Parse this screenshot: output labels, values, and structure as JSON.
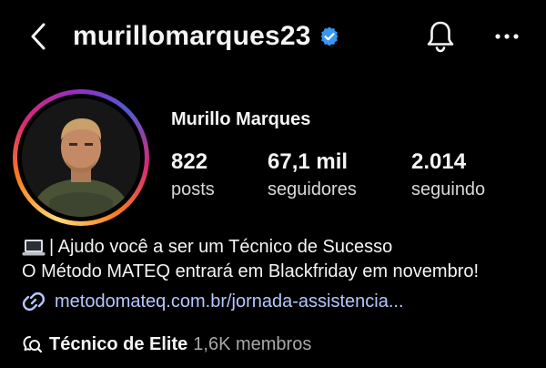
{
  "header": {
    "username": "murillomarques23",
    "icons": {
      "back": "chevron-left-icon",
      "verified": "verified-badge-icon",
      "notifications": "bell-icon",
      "more": "ellipsis-icon"
    },
    "verified_color": "#3897f0"
  },
  "profile": {
    "display_name": "Murillo Marques",
    "avatar_ring_colors": [
      "#feda75",
      "#fa7e1e",
      "#d62976",
      "#962fbf",
      "#4f5bd5"
    ],
    "stats": [
      {
        "value": "822",
        "label": "posts"
      },
      {
        "value": "67,1 mil",
        "label": "seguidores"
      },
      {
        "value": "2.014",
        "label": "seguindo"
      }
    ]
  },
  "bio": {
    "emoji": "laptop-icon",
    "line1": "| Ajudo você a ser um Técnico de Sucesso",
    "line2": "O Método MATEQ entrará em Blackfriday em novembro!"
  },
  "link": {
    "icon": "link-icon",
    "text": "metodomateq.com.br/jornada-assistencia...",
    "color": "#b6c6ff"
  },
  "community": {
    "icon": "community-search-icon",
    "name": "Técnico de Elite",
    "members": "1,6K membros"
  }
}
